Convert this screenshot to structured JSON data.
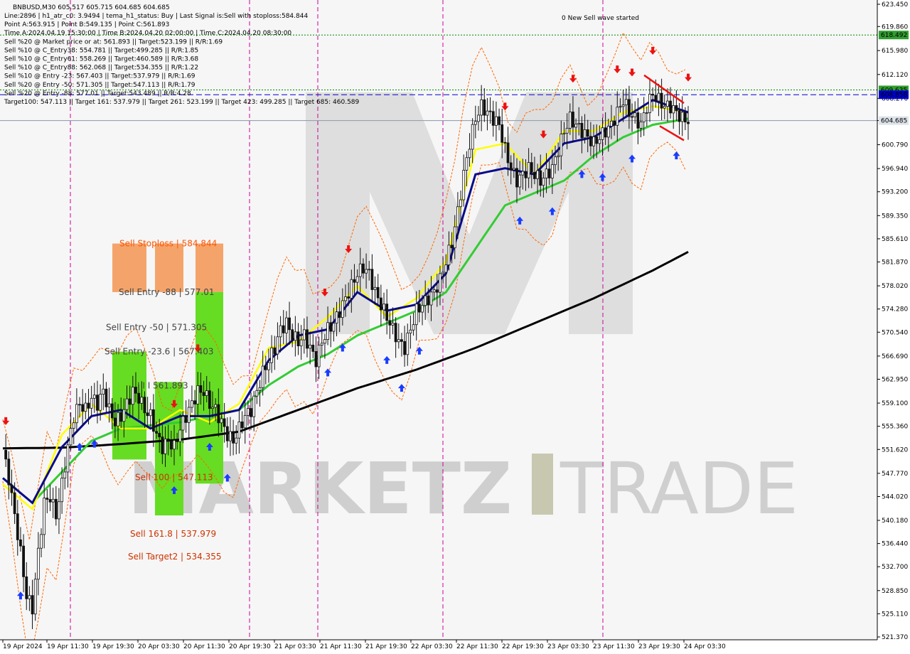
{
  "header": {
    "symbol_line": "BNBUSD,M30  605.517 605.715 604.685 604.685",
    "info_lines": [
      "Line:2896  |  h1_atr_c0: 3.9494  |  tema_h1_status: Buy  |  Last Signal is:Sell with stoploss:584.844",
      "Point A:563.915  |  Point B:549.135  |  Point C:561.893",
      "Time A:2024.04.19 15:30:00  |  Time B:2024.04.20 02:00:00  |  Time C:2024.04.20 08:30:00",
      "Sell %20 @ Market price or at: 561.893  ||  Target:523.199  ||  R/R:1.69",
      "Sell %10 @ C_Entry38: 554.781  ||  Target:499.285  ||  R/R:1.85",
      "Sell %10 @ C_Entry61: 558.269  ||  Target:460.589  ||  R/R:3.68",
      "Sell %10 @ C_Entry88: 562.068  ||  Target:534.355  ||  R/R:1.22",
      "Sell %10 @ Entry -23: 567.403  ||  Target:537.979  ||  R/R:1.69",
      "Sell %20 @ Entry -50: 571.305  ||  Target:547.113  ||  R/R:1.79",
      "Sell %20 @ Entry -88: 577.01  ||  Target:543.489  ||  R/R:4.28",
      "Target100: 547.113  ||  Target 161: 537.979  ||  Target 261: 523.199  ||  Target 423: 499.285  ||  Target 685: 460.589"
    ]
  },
  "annotation_top": "0 New Sell wave started",
  "watermark": {
    "left": "MARKETZ",
    "right": "TRADE"
  },
  "colors": {
    "background": "#f6f6f6",
    "stoploss_zone": "#f4a46a",
    "entry_zone": "#66dd22",
    "candle": "#111111",
    "ma_black": "#000000",
    "ma_navy": "#0a0a8c",
    "ma_green": "#33cc33",
    "ma_yellow": "#ffff00",
    "band_orange": "#ff6600",
    "level_blue": "#0000cc",
    "level_green": "#008800",
    "vline_magenta": "#cc0099",
    "arrow_up": "#1a3cff",
    "arrow_down": "#ee1111"
  },
  "zone_labels": {
    "stoploss": "Sell Stoploss | 584.844",
    "entry_88": "Sell Entry -88 | 577.01",
    "entry_50": "Sell Entry -50 | 571.305",
    "entry_23": "Sell Entry -23.6 | 567.403",
    "point_c": "I I I 561.893",
    "sell_100": "Sell 100 | 547.113",
    "sell_161": "Sell 161.8 | 537.979",
    "sell_target2": "Sell Target2 | 534.355"
  },
  "price_badges": {
    "green_top": "618.492",
    "green_mid": "609.635",
    "blue": "608.858",
    "current": "604.685"
  },
  "chart_data": {
    "type": "candlestick",
    "symbol": "BNBUSD",
    "timeframe": "M30",
    "ylim": [
      521.37,
      623.45
    ],
    "y_ticks": [
      "623.450",
      "619.860",
      "615.980",
      "612.120",
      "608.270",
      "604.685",
      "600.790",
      "596.940",
      "593.200",
      "589.350",
      "585.610",
      "581.870",
      "578.020",
      "574.280",
      "570.540",
      "566.690",
      "562.950",
      "559.100",
      "555.360",
      "551.620",
      "547.770",
      "544.020",
      "540.180",
      "536.440",
      "532.700",
      "528.850",
      "525.110",
      "521.370"
    ],
    "x_ticks": [
      "19 Apr 2024",
      "19 Apr 11:30",
      "19 Apr 19:30",
      "20 Apr 03:30",
      "20 Apr 11:30",
      "20 Apr 19:30",
      "21 Apr 03:30",
      "21 Apr 11:30",
      "21 Apr 19:30",
      "22 Apr 03:30",
      "22 Apr 11:30",
      "22 Apr 19:30",
      "23 Apr 03:30",
      "23 Apr 11:30",
      "23 Apr 19:30",
      "24 Apr 03:30"
    ],
    "levels": [
      {
        "name": "green_top",
        "value": 618.492,
        "style": "dotted"
      },
      {
        "name": "green_mid",
        "value": 609.635,
        "style": "dotted"
      },
      {
        "name": "blue",
        "value": 608.858,
        "style": "dashed"
      },
      {
        "name": "current",
        "value": 604.685,
        "style": "solid"
      }
    ],
    "zones": {
      "stoploss_top": 584.844,
      "entry_88": 577.01,
      "entry_50": 571.305,
      "entry_23": 567.403,
      "point_c": 561.893,
      "sell_100": 547.113,
      "sell_161": 537.979,
      "sell_target2": 534.355
    },
    "close_path": [
      [
        0,
        551.5
      ],
      [
        2,
        547
      ],
      [
        4,
        541
      ],
      [
        6,
        535
      ],
      [
        8,
        528
      ],
      [
        10,
        526
      ],
      [
        12,
        535
      ],
      [
        14,
        543
      ],
      [
        16,
        544
      ],
      [
        18,
        541
      ],
      [
        20,
        546
      ],
      [
        22,
        552
      ],
      [
        24,
        557
      ],
      [
        26,
        559
      ],
      [
        28,
        558
      ],
      [
        30,
        560
      ],
      [
        32,
        559
      ],
      [
        34,
        561
      ],
      [
        36,
        558
      ],
      [
        38,
        556
      ],
      [
        40,
        557
      ],
      [
        42,
        559
      ],
      [
        44,
        561
      ],
      [
        46,
        560
      ],
      [
        48,
        558
      ],
      [
        50,
        557
      ],
      [
        52,
        554
      ],
      [
        54,
        552
      ],
      [
        56,
        553
      ],
      [
        58,
        552
      ],
      [
        60,
        555
      ],
      [
        62,
        557
      ],
      [
        64,
        559
      ],
      [
        66,
        561
      ],
      [
        68,
        561
      ],
      [
        70,
        559
      ],
      [
        72,
        558
      ],
      [
        74,
        556
      ],
      [
        76,
        554
      ],
      [
        78,
        553
      ],
      [
        80,
        555
      ],
      [
        82,
        557
      ],
      [
        84,
        558
      ],
      [
        86,
        561
      ],
      [
        88,
        564
      ],
      [
        90,
        566
      ],
      [
        92,
        568
      ],
      [
        94,
        571
      ],
      [
        96,
        572
      ],
      [
        98,
        570
      ],
      [
        100,
        569
      ],
      [
        102,
        570
      ],
      [
        104,
        568
      ],
      [
        106,
        566
      ],
      [
        108,
        569
      ],
      [
        110,
        571
      ],
      [
        112,
        572
      ],
      [
        114,
        574
      ],
      [
        116,
        576
      ],
      [
        118,
        578
      ],
      [
        120,
        580
      ],
      [
        122,
        581
      ],
      [
        124,
        580
      ],
      [
        126,
        577
      ],
      [
        128,
        575
      ],
      [
        130,
        573
      ],
      [
        132,
        571
      ],
      [
        134,
        569
      ],
      [
        136,
        568
      ],
      [
        138,
        571
      ],
      [
        140,
        574
      ],
      [
        142,
        575
      ],
      [
        144,
        576
      ],
      [
        146,
        577
      ],
      [
        148,
        579
      ],
      [
        150,
        582
      ],
      [
        152,
        585
      ],
      [
        154,
        590
      ],
      [
        156,
        596
      ],
      [
        158,
        601
      ],
      [
        160,
        605
      ],
      [
        162,
        607
      ],
      [
        164,
        606
      ],
      [
        166,
        605
      ],
      [
        168,
        604
      ],
      [
        170,
        600
      ],
      [
        172,
        597
      ],
      [
        174,
        595
      ],
      [
        176,
        596
      ],
      [
        178,
        597
      ],
      [
        180,
        596
      ],
      [
        182,
        595
      ],
      [
        184,
        596
      ],
      [
        186,
        597
      ],
      [
        188,
        600
      ],
      [
        190,
        603
      ],
      [
        192,
        605
      ],
      [
        194,
        604
      ],
      [
        196,
        603
      ],
      [
        198,
        602
      ],
      [
        200,
        601
      ],
      [
        202,
        602
      ],
      [
        204,
        603
      ],
      [
        206,
        604
      ],
      [
        208,
        606
      ],
      [
        210,
        608
      ],
      [
        212,
        606
      ],
      [
        214,
        605
      ],
      [
        216,
        604
      ],
      [
        218,
        607
      ],
      [
        220,
        609
      ],
      [
        222,
        608
      ],
      [
        224,
        607
      ],
      [
        226,
        607
      ],
      [
        228,
        606
      ],
      [
        230,
        605
      ],
      [
        232,
        604.685
      ]
    ],
    "ma_black": [
      [
        0,
        551.8
      ],
      [
        20,
        551.9
      ],
      [
        40,
        552.5
      ],
      [
        60,
        553.2
      ],
      [
        80,
        554.5
      ],
      [
        100,
        558
      ],
      [
        120,
        561.5
      ],
      [
        140,
        564.5
      ],
      [
        160,
        568
      ],
      [
        180,
        572
      ],
      [
        200,
        576
      ],
      [
        220,
        580.5
      ],
      [
        232,
        583.5
      ]
    ],
    "ma_green": [
      [
        0,
        547
      ],
      [
        10,
        543
      ],
      [
        20,
        548
      ],
      [
        30,
        553
      ],
      [
        40,
        555
      ],
      [
        50,
        555.5
      ],
      [
        60,
        556
      ],
      [
        70,
        557
      ],
      [
        80,
        558
      ],
      [
        90,
        562
      ],
      [
        100,
        565
      ],
      [
        110,
        567
      ],
      [
        120,
        570
      ],
      [
        130,
        572
      ],
      [
        140,
        574
      ],
      [
        150,
        577
      ],
      [
        160,
        584
      ],
      [
        170,
        591
      ],
      [
        180,
        593
      ],
      [
        190,
        595
      ],
      [
        200,
        599
      ],
      [
        210,
        602
      ],
      [
        220,
        604
      ],
      [
        232,
        605
      ]
    ],
    "ma_navy": [
      [
        0,
        547
      ],
      [
        10,
        543
      ],
      [
        20,
        552
      ],
      [
        30,
        557
      ],
      [
        40,
        558
      ],
      [
        50,
        555
      ],
      [
        60,
        557
      ],
      [
        70,
        557
      ],
      [
        80,
        558
      ],
      [
        90,
        566
      ],
      [
        100,
        570
      ],
      [
        110,
        571
      ],
      [
        120,
        577
      ],
      [
        130,
        574
      ],
      [
        140,
        575
      ],
      [
        150,
        580
      ],
      [
        160,
        596
      ],
      [
        170,
        597
      ],
      [
        180,
        596
      ],
      [
        190,
        601
      ],
      [
        200,
        602
      ],
      [
        210,
        605
      ],
      [
        220,
        608
      ],
      [
        232,
        606
      ]
    ],
    "ma_yellow": [
      [
        0,
        546
      ],
      [
        10,
        542
      ],
      [
        20,
        554
      ],
      [
        30,
        559
      ],
      [
        40,
        555
      ],
      [
        50,
        555
      ],
      [
        60,
        558
      ],
      [
        70,
        556
      ],
      [
        80,
        559
      ],
      [
        90,
        568
      ],
      [
        100,
        569
      ],
      [
        110,
        573
      ],
      [
        120,
        578
      ],
      [
        130,
        573
      ],
      [
        140,
        576
      ],
      [
        150,
        582
      ],
      [
        160,
        600
      ],
      [
        170,
        601
      ],
      [
        180,
        596
      ],
      [
        190,
        603
      ],
      [
        200,
        603
      ],
      [
        210,
        606
      ],
      [
        220,
        607
      ],
      [
        232,
        606
      ]
    ]
  }
}
